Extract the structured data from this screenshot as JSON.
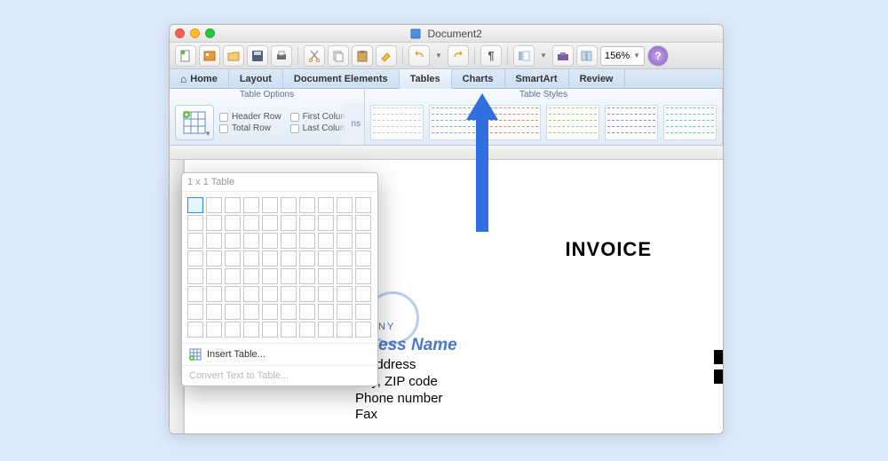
{
  "window": {
    "title": "Document2"
  },
  "toolbar": {
    "zoom": "156%"
  },
  "tabs": {
    "home": "Home",
    "layout": "Layout",
    "docel": "Document Elements",
    "tables": "Tables",
    "charts": "Charts",
    "smartart": "SmartArt",
    "review": "Review"
  },
  "ribbon": {
    "table_options_title": "Table Options",
    "table_styles_title": "Table Styles",
    "header_row": "Header Row",
    "total_row": "Total Row",
    "first_col": "First Column",
    "last_col": "Last Column",
    "shading_fragment": "ns"
  },
  "popover": {
    "size": "1 x 1 Table",
    "insert": "Insert Table...",
    "convert": "Convert Text to Table..."
  },
  "doc": {
    "invoice": "INVOICE",
    "company_frag": "NY",
    "bizname_frag": "ess Name",
    "street_frag": "Street Address",
    "city": "City, ZIP code",
    "phone": "Phone number",
    "fax": "Fax"
  }
}
